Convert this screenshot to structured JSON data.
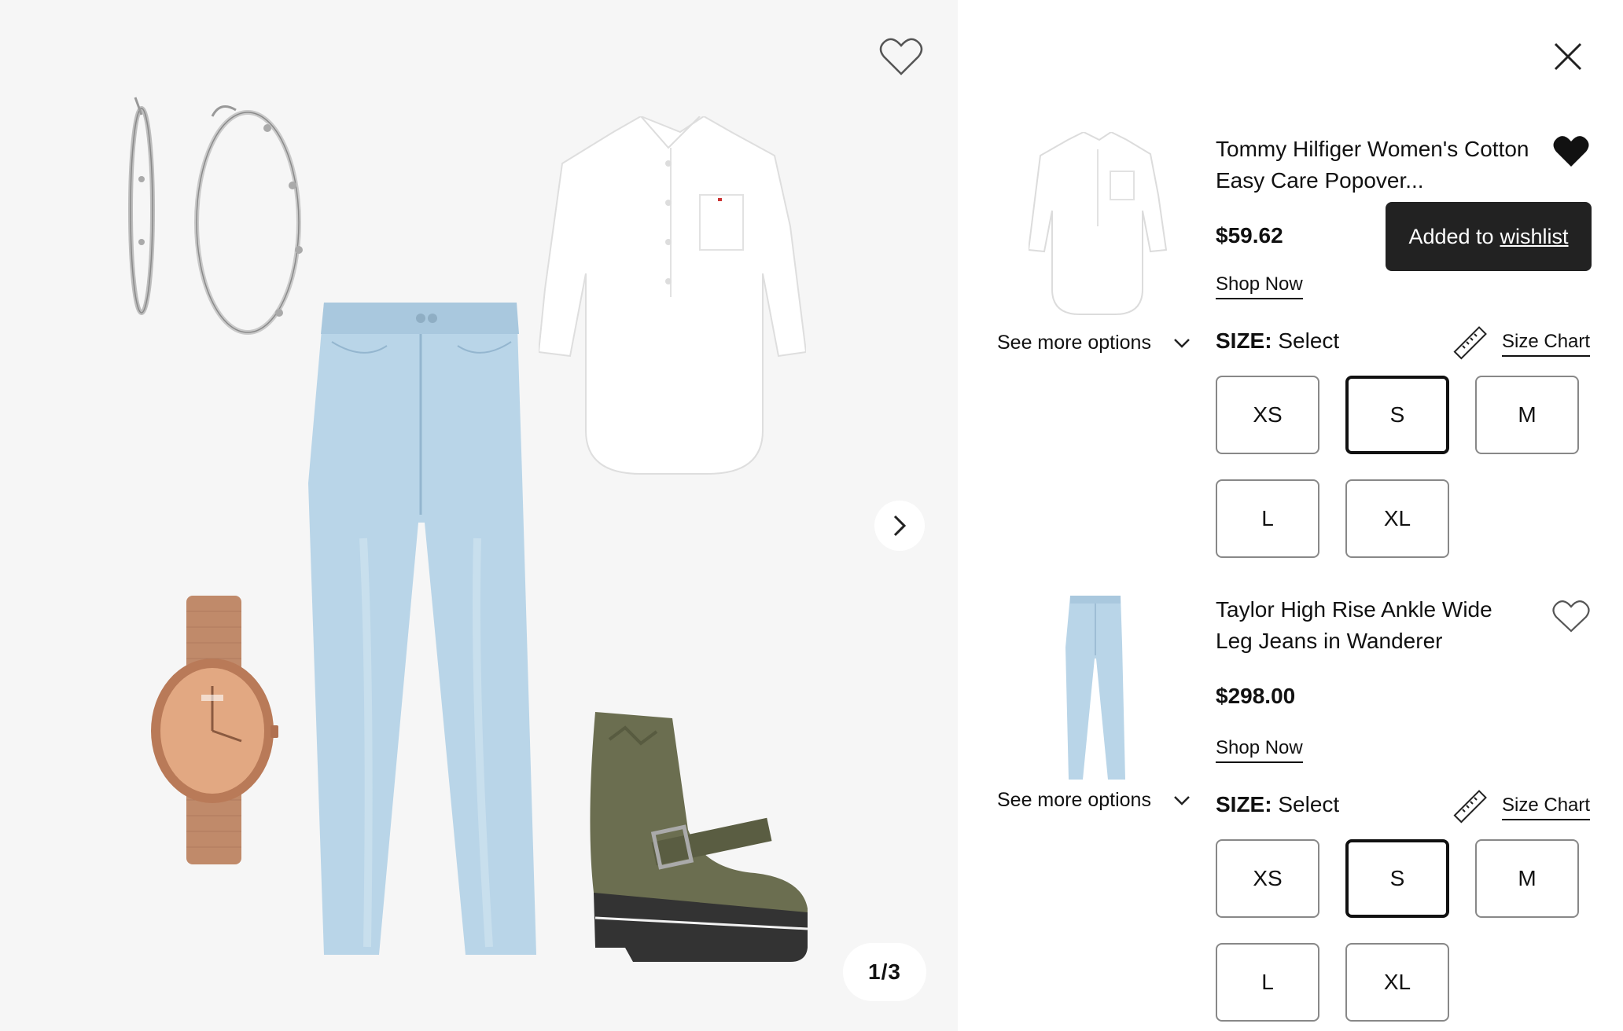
{
  "outfit": {
    "counter": "1/3",
    "icons": {
      "favorite": "heart-outline-icon",
      "next": "chevron-right-icon"
    },
    "pieces": [
      "earrings-image",
      "shirt-image",
      "jeans-image",
      "watch-image",
      "boots-image"
    ]
  },
  "details": {
    "close_icon": "close-icon",
    "toast": {
      "text": "Added to",
      "link": "wishlist"
    },
    "items": [
      {
        "title": "Tommy Hilfiger Women's Cotton Easy Care Popover...",
        "price": "$59.62",
        "shop_now": "Shop Now",
        "see_more": "See more options",
        "size_prefix": "SIZE:",
        "size_value": "Select",
        "size_chart": "Size Chart",
        "wishlisted": true,
        "sizes": [
          "XS",
          "S",
          "M",
          "L",
          "XL"
        ],
        "selected_size": "S"
      },
      {
        "title": "Taylor High Rise Ankle Wide Leg Jeans in Wanderer",
        "price": "$298.00",
        "shop_now": "Shop Now",
        "see_more": "See more options",
        "size_prefix": "SIZE:",
        "size_value": "Select",
        "size_chart": "Size Chart",
        "wishlisted": false,
        "sizes": [
          "XS",
          "S",
          "M",
          "L",
          "XL"
        ],
        "selected_size": "S"
      }
    ]
  },
  "colors": {
    "outfit_bg": "#f6f6f6",
    "jeans": "#b9d5e8",
    "boots": "#6b6e50",
    "watch": "#c88a66",
    "toast_bg": "#222222"
  }
}
